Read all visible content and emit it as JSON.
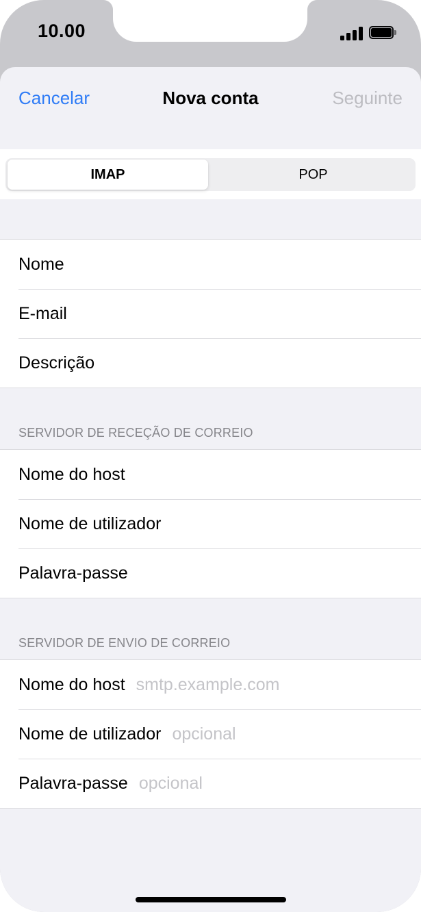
{
  "status": {
    "time": "10.00"
  },
  "nav": {
    "cancel": "Cancelar",
    "title": "Nova conta",
    "next": "Seguinte"
  },
  "segment": {
    "options": [
      "IMAP",
      "POP"
    ],
    "selected": "IMAP"
  },
  "account": {
    "fields": [
      {
        "label": "Nome",
        "value": "",
        "placeholder": ""
      },
      {
        "label": "E-mail",
        "value": "",
        "placeholder": ""
      },
      {
        "label": "Descrição",
        "value": "",
        "placeholder": ""
      }
    ]
  },
  "incoming": {
    "header": "SERVIDOR DE RECEÇÃO DE CORREIO",
    "fields": [
      {
        "label": "Nome do host",
        "value": "",
        "placeholder": ""
      },
      {
        "label": "Nome de utilizador",
        "value": "",
        "placeholder": ""
      },
      {
        "label": "Palavra-passe",
        "value": "",
        "placeholder": ""
      }
    ]
  },
  "outgoing": {
    "header": "SERVIDOR DE ENVIO DE CORREIO",
    "fields": [
      {
        "label": "Nome do host",
        "value": "",
        "placeholder": "smtp.example.com"
      },
      {
        "label": "Nome de utilizador",
        "value": "",
        "placeholder": "opcional"
      },
      {
        "label": "Palavra-passe",
        "value": "",
        "placeholder": "opcional"
      }
    ]
  },
  "colors": {
    "accent": "#2f7cf6",
    "disabled": "#bcbcc1",
    "grouped_background": "#f1f1f6",
    "separator": "#dcdce0"
  }
}
